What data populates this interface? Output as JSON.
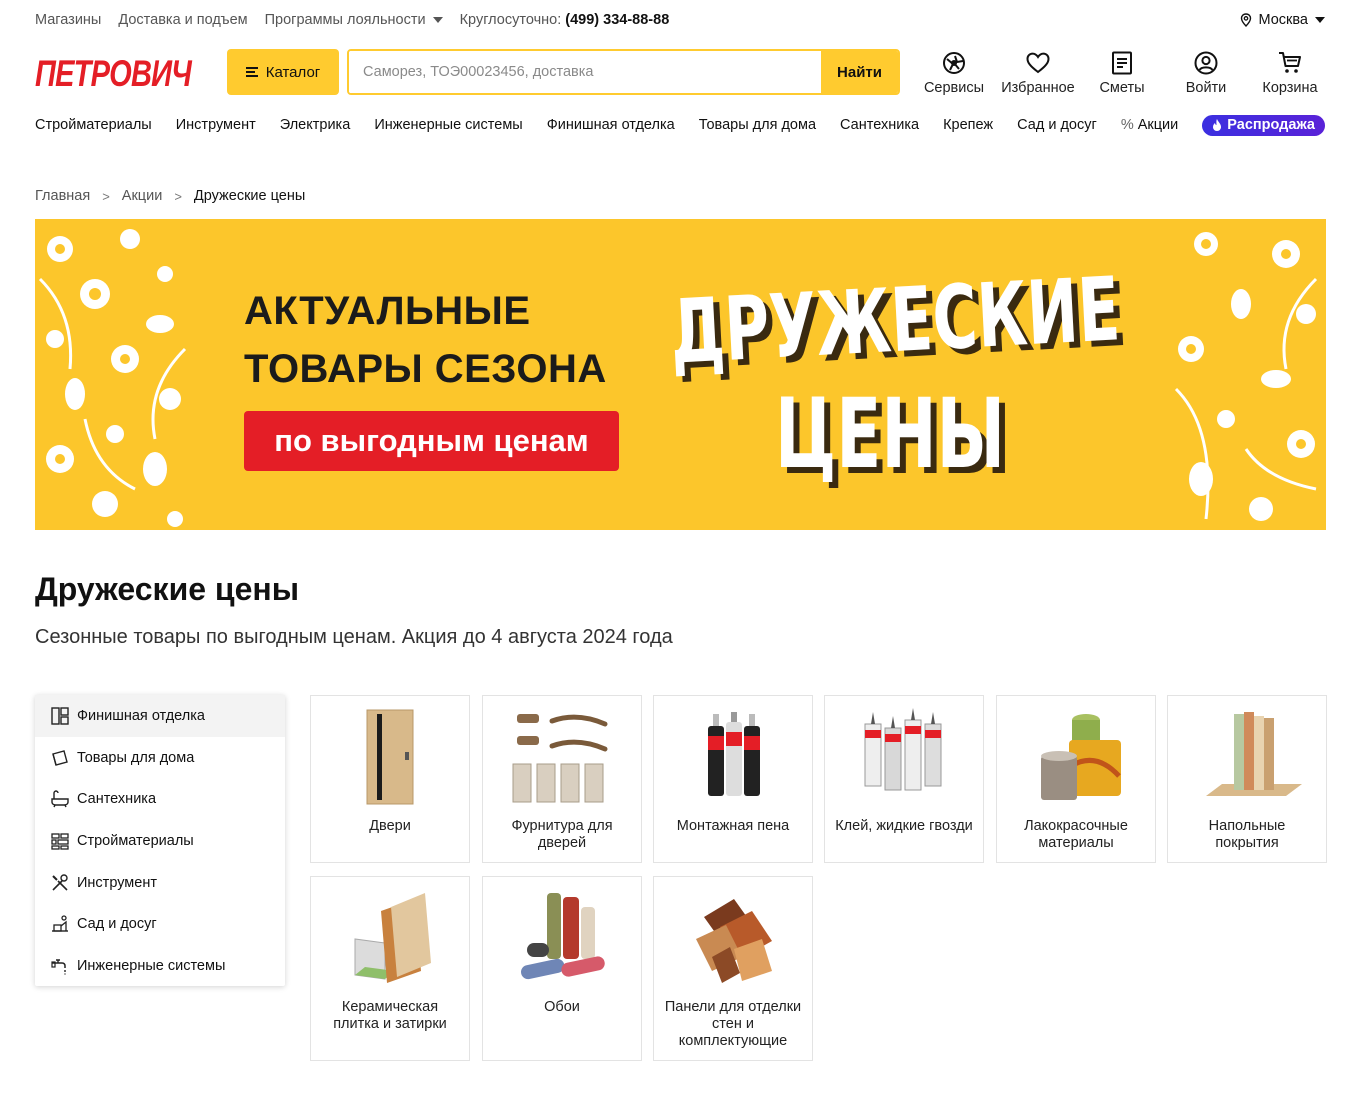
{
  "topbar": {
    "links": [
      "Магазины",
      "Доставка и подъем",
      "Программы лояльности"
    ],
    "phone_label": "Круглосуточно:",
    "phone": "(499) 334-88-88",
    "city": "Москва"
  },
  "header": {
    "logo_text": "ПЕТРОВИЧ",
    "catalog_label": "Каталог",
    "search_placeholder": "Саморез, ТОЭ00023456, доставка",
    "search_button": "Найти",
    "icons": [
      {
        "label": "Сервисы",
        "icon": "services-icon"
      },
      {
        "label": "Избранное",
        "icon": "heart-icon"
      },
      {
        "label": "Сметы",
        "icon": "estimate-icon"
      },
      {
        "label": "Войти",
        "icon": "user-icon"
      },
      {
        "label": "Корзина",
        "icon": "cart-icon"
      }
    ]
  },
  "catnav": {
    "items": [
      "Стройматериалы",
      "Инструмент",
      "Электрика",
      "Инженерные системы",
      "Финишная отделка",
      "Товары для дома",
      "Сантехника",
      "Крепеж",
      "Сад и досуг"
    ],
    "promo": "Акции",
    "sale": "Распродажа"
  },
  "breadcrumb": [
    "Главная",
    "Акции",
    "Дружеские цены"
  ],
  "banner": {
    "line1": "АКТУАЛЬНЫЕ",
    "line2": "ТОВАРЫ СЕЗОНА",
    "cta": "по выгодным ценам",
    "title1": "ДРУЖЕСКИЕ",
    "title2": "ЦЕНЫ"
  },
  "page": {
    "title": "Дружеские цены",
    "subtitle": "Сезонные товары по выгодным ценам. Акция до 4 августа 2024 года"
  },
  "leftmenu": [
    {
      "label": "Финишная отделка",
      "icon": "finishing-icon"
    },
    {
      "label": "Товары для дома",
      "icon": "home-goods-icon"
    },
    {
      "label": "Сантехника",
      "icon": "bathtub-icon"
    },
    {
      "label": "Стройматериалы",
      "icon": "bricks-icon"
    },
    {
      "label": "Инструмент",
      "icon": "tools-icon"
    },
    {
      "label": "Сад и досуг",
      "icon": "garden-icon"
    },
    {
      "label": "Инженерные системы",
      "icon": "faucet-icon"
    }
  ],
  "tiles": [
    {
      "label": "Двери"
    },
    {
      "label": "Фурнитура для дверей"
    },
    {
      "label": "Монтажная пена"
    },
    {
      "label": "Клей, жидкие гвозди"
    },
    {
      "label": "Лакокрасочные материалы"
    },
    {
      "label": "Напольные покрытия"
    },
    {
      "label": "Керамическая плитка и затирки"
    },
    {
      "label": "Обои"
    },
    {
      "label": "Панели для отделки стен и комплектующие"
    }
  ],
  "colors": {
    "accent": "#ffcb2f",
    "brand_red": "#e41e26",
    "sale": "#3b2fe0"
  }
}
